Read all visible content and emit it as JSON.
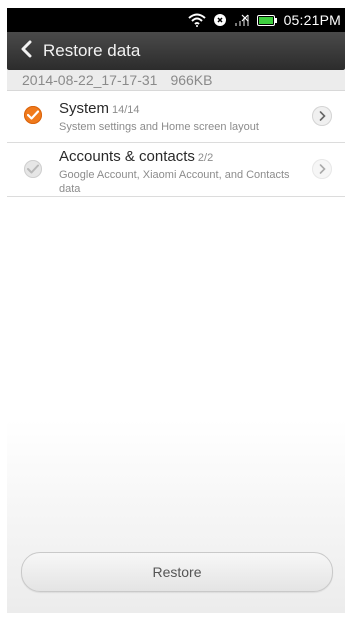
{
  "status_bar": {
    "time": "05:21PM",
    "icons": [
      "wifi-icon",
      "alarm-icon",
      "signal-icon",
      "battery-icon"
    ]
  },
  "header": {
    "title": "Restore data",
    "back_icon": "back-arrow-icon"
  },
  "backup": {
    "date": "2014-08-22_17-17-31",
    "size": "966KB"
  },
  "items": [
    {
      "title": "System",
      "count": "14/14",
      "description": "System settings and Home screen layout",
      "checked": true
    },
    {
      "title": "Accounts & contacts",
      "count": "2/2",
      "description": "Google Account, Xiaomi Account, and Contacts data",
      "checked": false
    }
  ],
  "restore_button": {
    "label": "Restore"
  },
  "colors": {
    "accent": "#f07a1c",
    "title_bar": "#333333",
    "status_bar": "#000000"
  }
}
